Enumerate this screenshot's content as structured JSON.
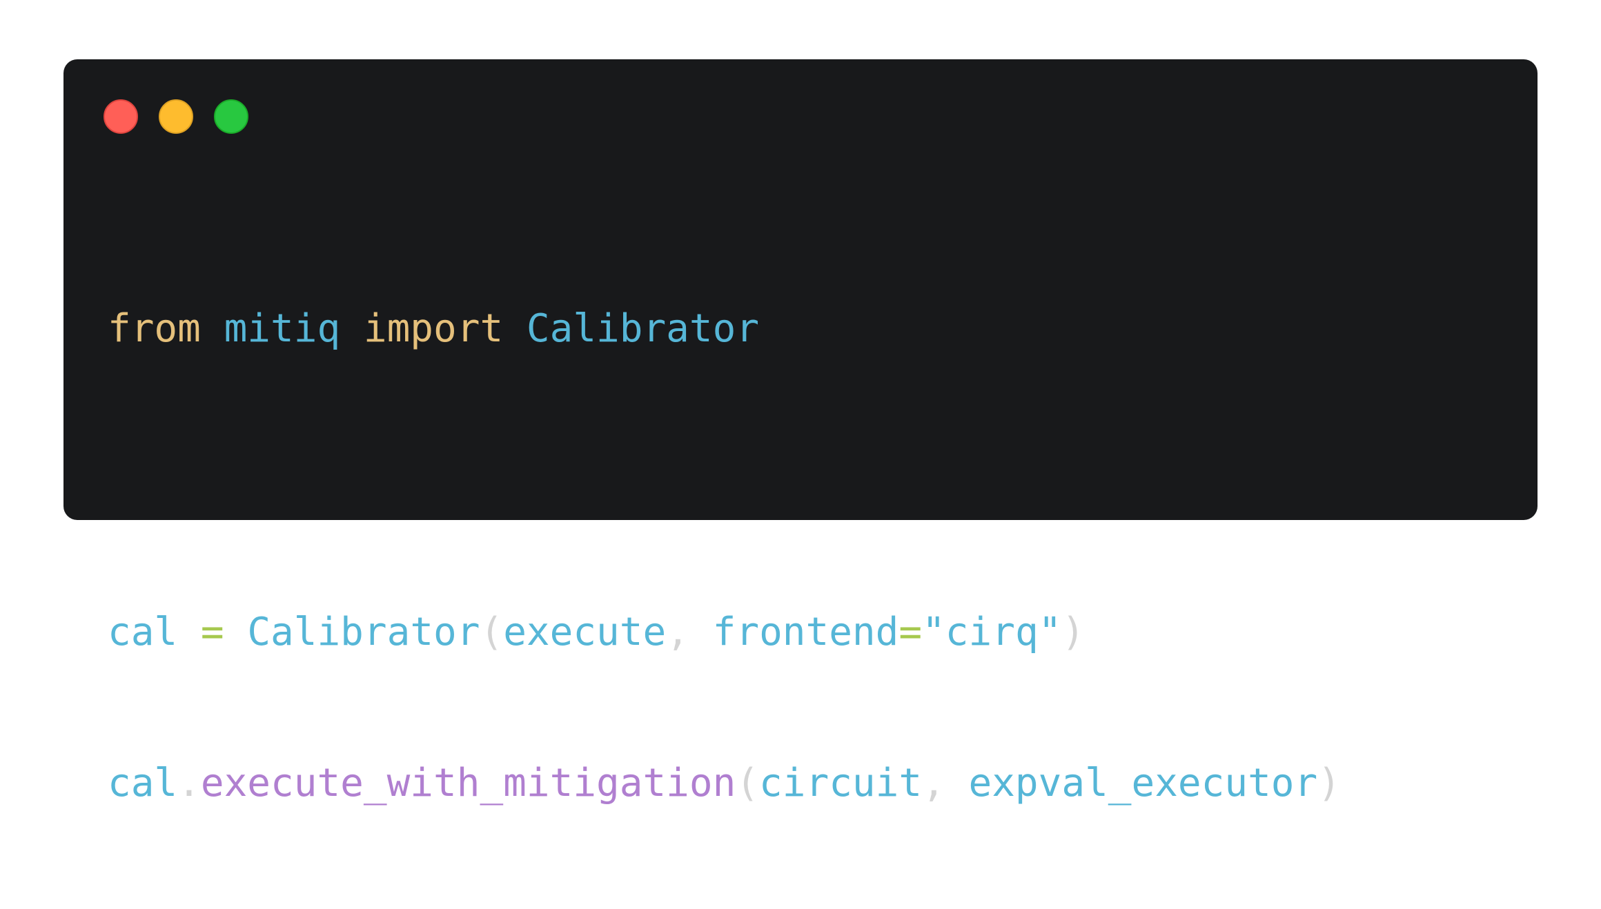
{
  "window": {
    "controls": {
      "close_color": "#ff5f57",
      "minimize_color": "#febc2e",
      "maximize_color": "#28c840"
    }
  },
  "code": {
    "line1": {
      "t1": "from",
      "t2": "mitiq",
      "t3": "import",
      "t4": "Calibrator"
    },
    "line3": {
      "t1": "cal",
      "t2": "=",
      "t3": "Calibrator",
      "t4": "(",
      "t5": "execute",
      "t6": ",",
      "t7": "frontend",
      "t8": "=",
      "t9": "\"cirq\"",
      "t10": ")"
    },
    "line4": {
      "t1": "cal",
      "t2": ".",
      "t3": "execute_with_mitigation",
      "t4": "(",
      "t5": "circuit",
      "t6": ",",
      "t7": "expval_executor",
      "t8": ")"
    }
  }
}
